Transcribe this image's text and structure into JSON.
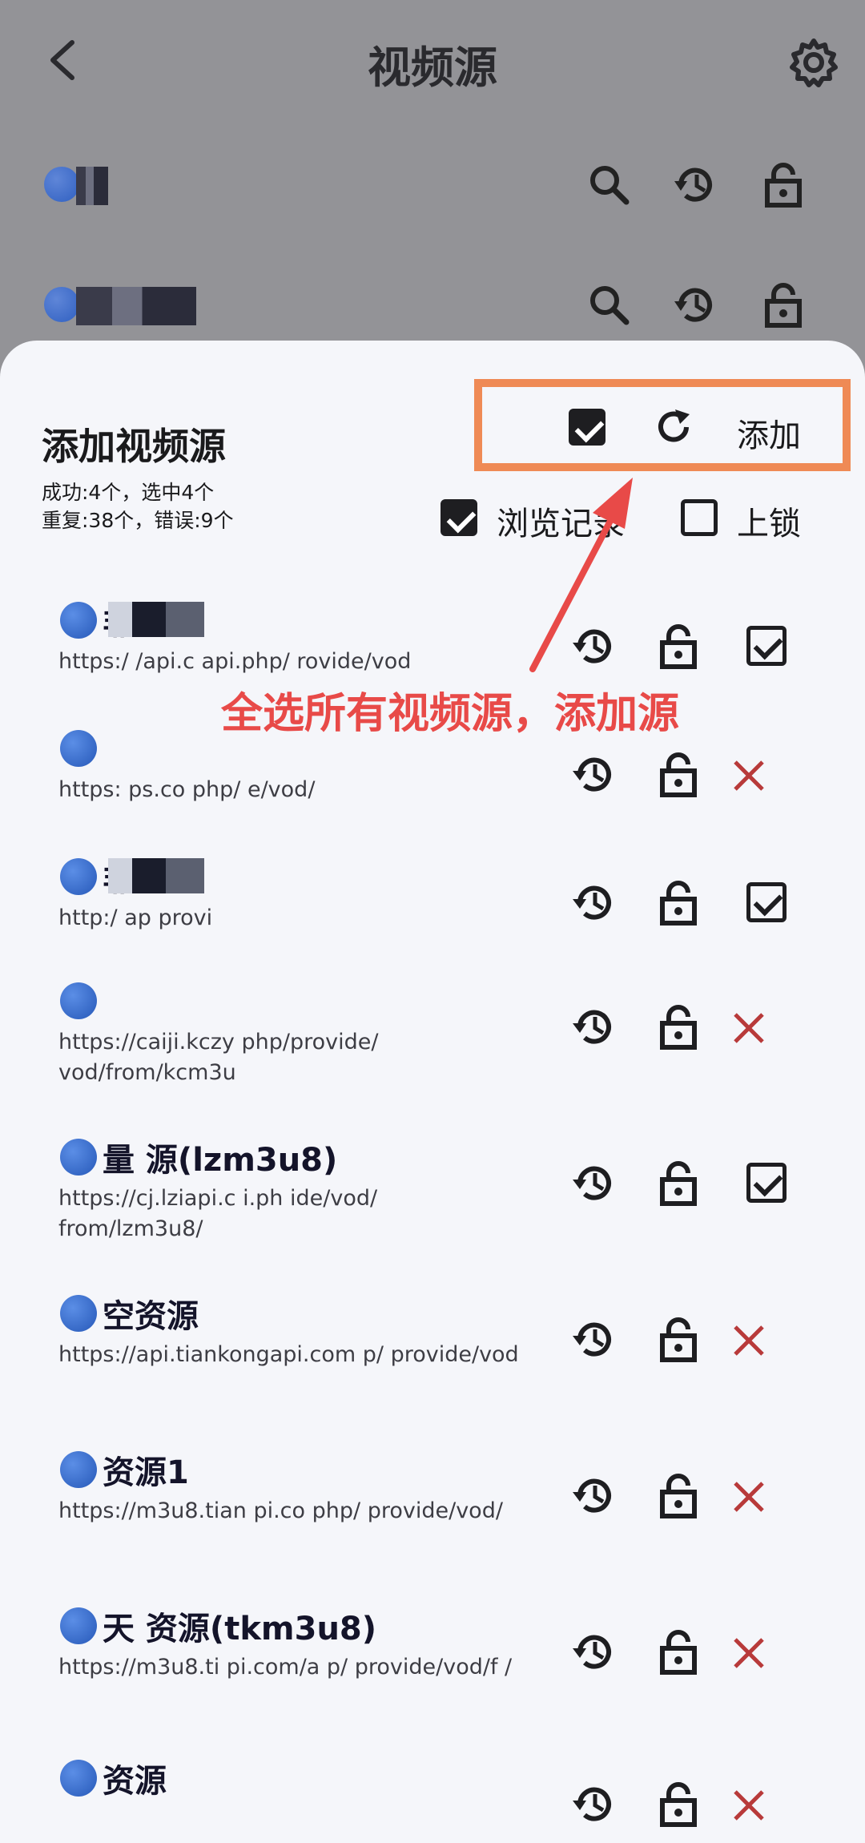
{
  "header": {
    "title": "视频源"
  },
  "sheet": {
    "title": "添加视频源",
    "stat_line1": "成功:4个，选中4个",
    "stat_line2": "重复:38个，错误:9个",
    "add_label": "添加",
    "history_label": "浏览记录",
    "lock_label": "上锁"
  },
  "annotation": "全选所有视频源，添加源",
  "sources": [
    {
      "name": "非",
      "url": "https:/     /api.c    api.php/   rovide/vod",
      "selected": true
    },
    {
      "name": "",
      "url": "https:     ps.co         php/        e/vod/",
      "selected": false
    },
    {
      "name": "非",
      "url": "http:/       ap              provi",
      "selected": true
    },
    {
      "name": "",
      "url": "https://caiji.kczy              php/provide/ vod/from/kcm3u",
      "selected": false
    },
    {
      "name": "量      源(lzm3u8)",
      "url": "https://cj.lziapi.c        i.ph      ide/vod/ from/lzm3u8/",
      "selected": true
    },
    {
      "name": "     空资源",
      "url": "https://api.tiankongapi.com         p/ provide/vod",
      "selected": false
    },
    {
      "name": "      资源1",
      "url": "https://m3u8.tian      pi.co      php/ provide/vod/",
      "selected": false
    },
    {
      "name": "天      资源(tkm3u8)",
      "url": "https://m3u8.ti       pi.com/a     p/ provide/vod/f          /",
      "selected": false
    },
    {
      "name": "      资源",
      "url": "",
      "selected": false
    }
  ]
}
